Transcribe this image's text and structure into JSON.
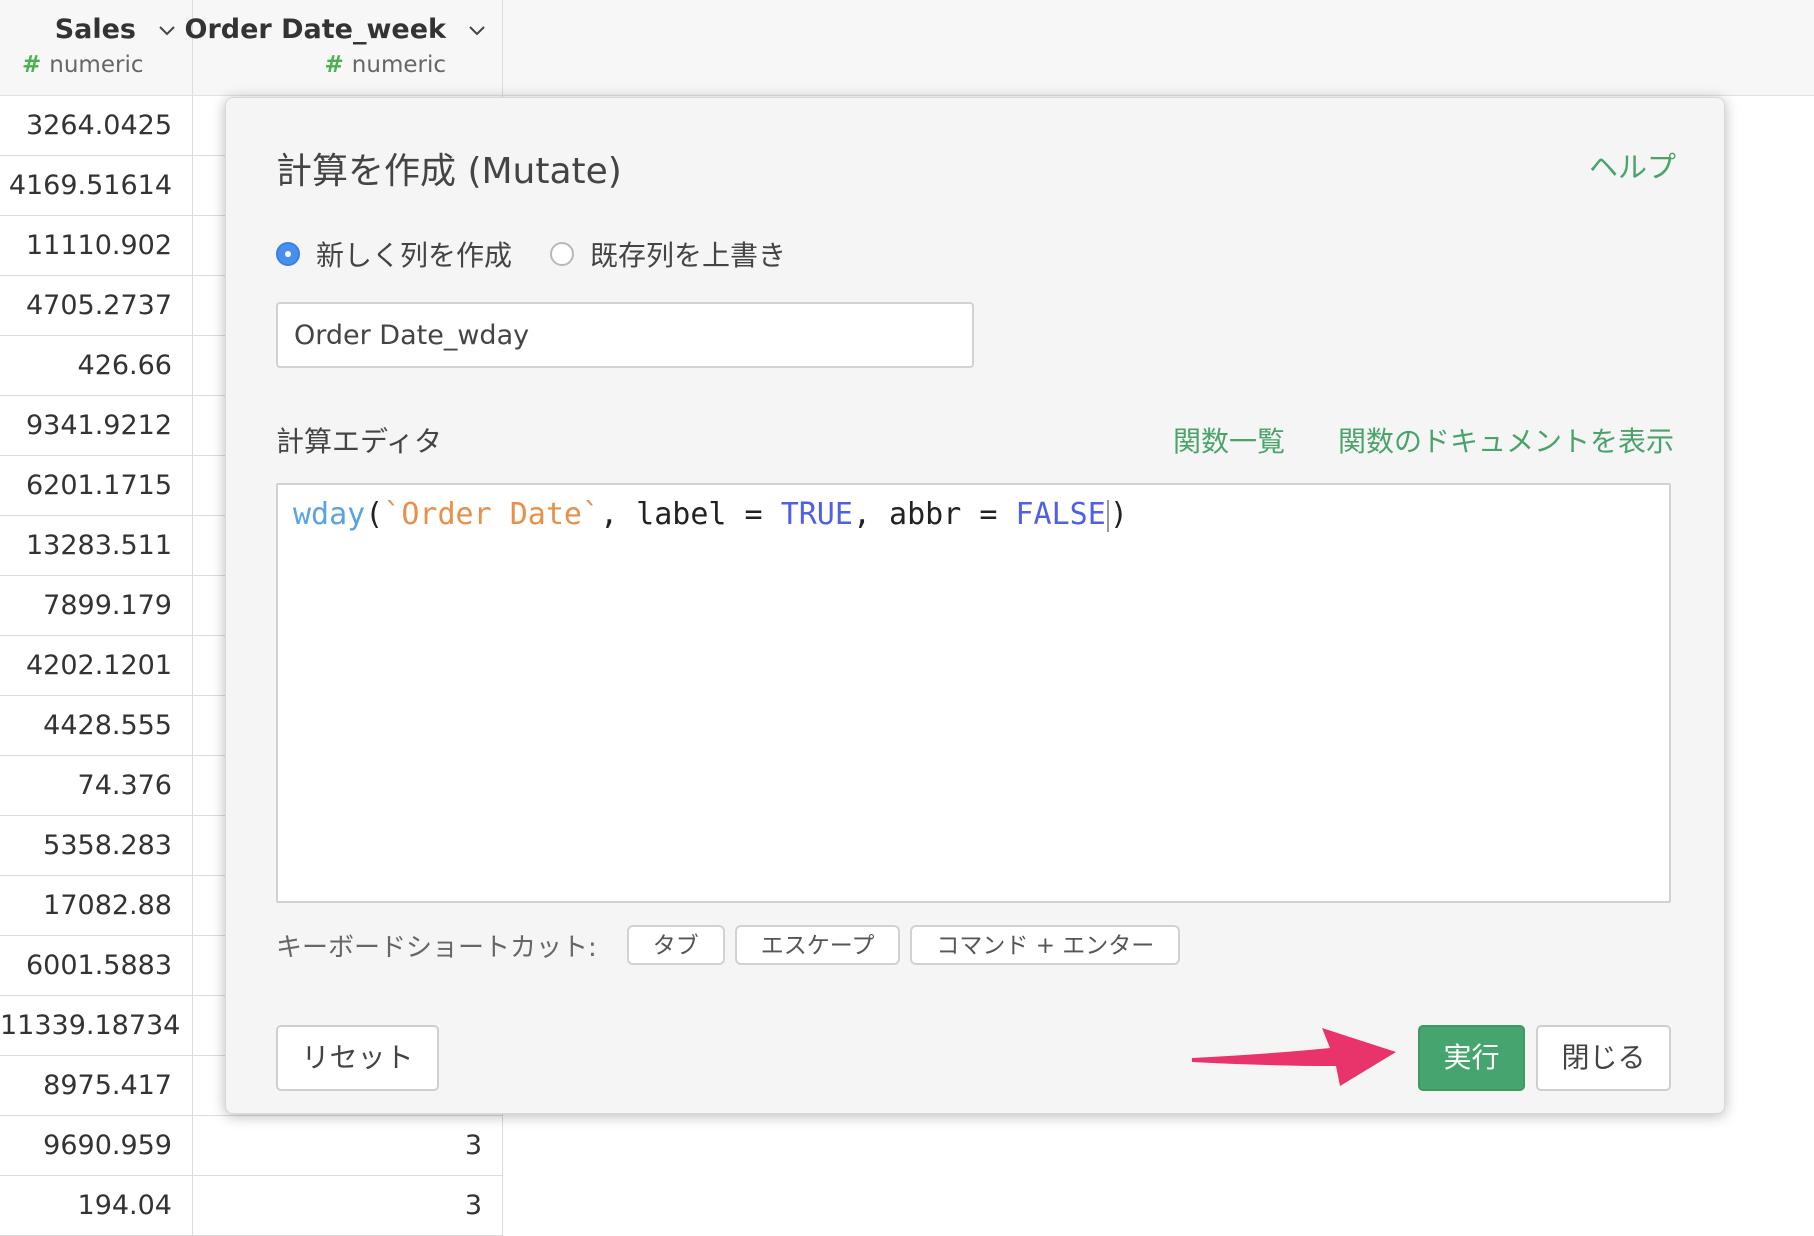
{
  "table": {
    "columns": [
      {
        "name": "Sales",
        "type": "numeric",
        "type_icon": "#"
      },
      {
        "name": "Order Date_week",
        "type": "numeric",
        "type_icon": "#"
      }
    ],
    "rows": [
      {
        "sales": "3264.0425",
        "week": ""
      },
      {
        "sales": "4169.51614",
        "week": ""
      },
      {
        "sales": "11110.902",
        "week": ""
      },
      {
        "sales": "4705.2737",
        "week": ""
      },
      {
        "sales": "426.66",
        "week": ""
      },
      {
        "sales": "9341.9212",
        "week": ""
      },
      {
        "sales": "6201.1715",
        "week": ""
      },
      {
        "sales": "13283.511",
        "week": ""
      },
      {
        "sales": "7899.179",
        "week": ""
      },
      {
        "sales": "4202.1201",
        "week": ""
      },
      {
        "sales": "4428.555",
        "week": ""
      },
      {
        "sales": "74.376",
        "week": ""
      },
      {
        "sales": "5358.283",
        "week": ""
      },
      {
        "sales": "17082.88",
        "week": ""
      },
      {
        "sales": "6001.5883",
        "week": ""
      },
      {
        "sales": "11339.18734",
        "week": ""
      },
      {
        "sales": "8975.417",
        "week": ""
      },
      {
        "sales": "9690.959",
        "week": "3"
      },
      {
        "sales": "194.04",
        "week": "3"
      }
    ]
  },
  "modal": {
    "title": "計算を作成 (Mutate)",
    "help": "ヘルプ",
    "radio": {
      "new_column": "新しく列を作成",
      "overwrite": "既存列を上書き",
      "selected": "new_column"
    },
    "column_name_value": "Order Date_wday",
    "editor_label": "計算エディタ",
    "function_list": "関数一覧",
    "function_docs": "関数のドキュメントを表示",
    "code": {
      "fn": "wday",
      "open": "(",
      "arg": "`Order Date`",
      "sep1": ", label = ",
      "kw1": "TRUE",
      "sep2": ", abbr = ",
      "kw2": "FALSE",
      "close": ")"
    },
    "shortcuts": {
      "label": "キーボードショートカット:",
      "keys": [
        "タブ",
        "エスケープ",
        "コマンド + エンター"
      ]
    },
    "buttons": {
      "reset": "リセット",
      "run": "実行",
      "close": "閉じる"
    }
  },
  "colors": {
    "accent_green": "#46a56e",
    "link_green": "#4aa36b",
    "radio_blue": "#4a8ef0",
    "arrow_pink": "#e8336b"
  }
}
